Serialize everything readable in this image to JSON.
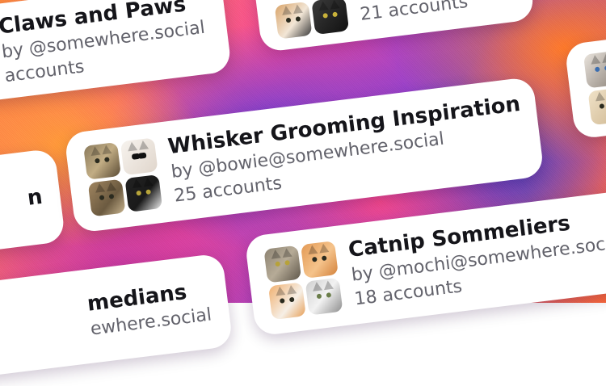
{
  "colors": {
    "card_bg": "#ffffff",
    "title": "#15151a",
    "meta": "#62626b",
    "backdrop": [
      "#ff8a3d",
      "#f54a9a",
      "#7b3fd9",
      "#3b3fcf"
    ]
  },
  "cards": [
    {
      "title": "Whisker Grooming Inspiration",
      "byline": "by @bowie@somewhere.social",
      "count": "25 accounts",
      "avatars": [
        "cat-tabby-avatar",
        "cat-white-sunglasses-avatar",
        "cat-tabby-avatar",
        "cat-tuxedo-avatar"
      ]
    },
    {
      "title": "Catnip Sommeliers",
      "byline": "by @mochi@somewhere.social",
      "count": "18 accounts",
      "avatars": [
        "cat-grey-tabby-avatar",
        "cat-orange-avatar",
        "cat-orange-white-avatar",
        "cat-silver-avatar"
      ]
    },
    {
      "title": "Claws and Paws",
      "byline": "by @somewhere.social",
      "count": "accounts"
    },
    {
      "title": "",
      "byline": "",
      "count": "21 accounts",
      "avatars": [
        "cat-calico-avatar",
        "cat-black-avatar"
      ]
    },
    {
      "title": "n"
    },
    {
      "title": "medians",
      "byline": "ewhere.social"
    }
  ]
}
